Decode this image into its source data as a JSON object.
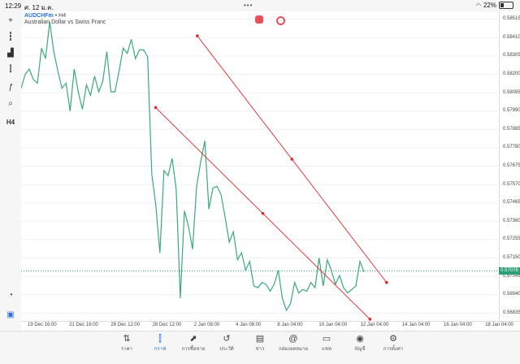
{
  "status": {
    "time": "12:29",
    "date": "ศ. 12 ม.ค.",
    "battery": "22%"
  },
  "symbol": {
    "name": "AUDCHFm",
    "suffix": "•",
    "timeframe": "H4",
    "description": "Australian Dollar vs Swiss Franc"
  },
  "left_tools": [
    "crosshair-icon",
    "indicators-icon",
    "bar-chart-icon",
    "candles-icon",
    "function-icon",
    "objects-icon",
    "H4"
  ],
  "price_axis": [
    "0.58515",
    "0.58410",
    "0.58305",
    "0.58200",
    "0.58095",
    "0.57990",
    "0.57885",
    "0.57780",
    "0.57675",
    "0.57570",
    "0.57465",
    "0.57360",
    "0.57255",
    "0.57150",
    "0.57045",
    "0.56940",
    "0.56835"
  ],
  "current_price": "0.57076",
  "time_axis": [
    "19 Dec 16:00",
    "21 Dec 16:00",
    "26 Dec 12:00",
    "28 Dec 12:00",
    "2 Jan 08:00",
    "4 Jan 08:00",
    "8 Jan 04:00",
    "10 Jan 04:00",
    "12 Jan 04:00",
    "14 Jan 04:00",
    "16 Jan 04:00",
    "18 Jan 04:00"
  ],
  "nav": [
    {
      "label": "ราคา",
      "icon": "quotes-icon",
      "active": false
    },
    {
      "label": "กราฟ",
      "icon": "chart-icon",
      "active": true
    },
    {
      "label": "การซื้อขาย",
      "icon": "trade-icon",
      "active": false
    },
    {
      "label": "ประวัติ",
      "icon": "history-icon",
      "active": false
    },
    {
      "label": "ข่าว",
      "icon": "news-icon",
      "active": false
    },
    {
      "label": "กล่องจดหมาย",
      "icon": "mailbox-icon",
      "active": false
    },
    {
      "label": "แชท",
      "icon": "chat-icon",
      "active": false
    },
    {
      "label": "บัญชี",
      "icon": "account-icon",
      "active": false
    },
    {
      "label": "การตั้งค่า",
      "icon": "settings-icon",
      "active": false
    }
  ],
  "colors": {
    "line": "#3aa97c",
    "trendline": "#e0262a",
    "current": "#2e9e78",
    "accent": "#2a6fdb"
  },
  "chart_data": {
    "type": "line",
    "symbol": "AUDCHFm",
    "timeframe": "H4",
    "y_range": [
      0.5679,
      0.5856
    ],
    "y": [
      0.5812,
      0.582,
      0.5823,
      0.5817,
      0.5815,
      0.5835,
      0.5829,
      0.585,
      0.5833,
      0.5822,
      0.5812,
      0.5815,
      0.5799,
      0.5823,
      0.581,
      0.58,
      0.5814,
      0.5808,
      0.5819,
      0.581,
      0.5816,
      0.5833,
      0.581,
      0.581,
      0.5822,
      0.5835,
      0.5832,
      0.584,
      0.5829,
      0.5834,
      0.5834,
      0.583,
      0.5763,
      0.5745,
      0.5718,
      0.5765,
      0.5762,
      0.5772,
      0.5754,
      0.5692,
      0.5742,
      0.5733,
      0.572,
      0.5756,
      0.577,
      0.5782,
      0.5743,
      0.5755,
      0.5756,
      0.5751,
      0.5738,
      0.5724,
      0.573,
      0.5714,
      0.5718,
      0.5708,
      0.5713,
      0.5699,
      0.5698,
      0.5701,
      0.57,
      0.5696,
      0.57,
      0.5708,
      0.5692,
      0.5685,
      0.5689,
      0.5701,
      0.5695,
      0.5697,
      0.5696,
      0.5701,
      0.5698,
      0.5715,
      0.5699,
      0.5714,
      0.5708,
      0.57,
      0.5705,
      0.5698,
      0.5695,
      0.5697,
      0.5699,
      0.5713,
      0.5707
    ],
    "trendlines": [
      {
        "x1": "2 Jan 08:00",
        "y1": 0.5842,
        "x2": "17 Jan 00:00",
        "y2": 0.5701
      },
      {
        "x1": "28 Dec 12:00",
        "y1": 0.5801,
        "x2": "12 Jan 12:00",
        "y2": 0.568
      }
    ]
  }
}
